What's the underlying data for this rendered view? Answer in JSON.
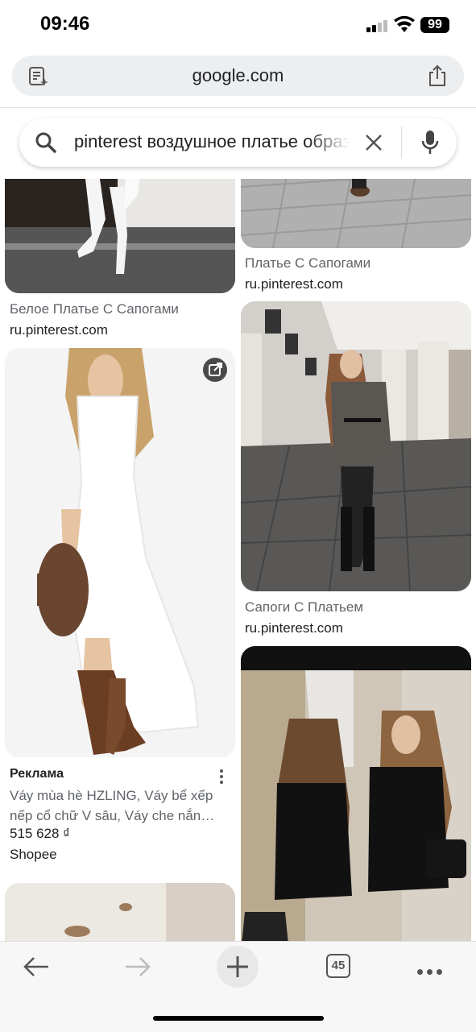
{
  "status": {
    "time": "09:46",
    "battery": "99"
  },
  "browser": {
    "url": "google.com",
    "tab_count": "45"
  },
  "search": {
    "query": "pinterest воздушное платье образ"
  },
  "results": [
    {
      "caption": "Белое Платье С Сапогами",
      "domain": "ru.pinterest.com"
    },
    {
      "caption": "Платье С Сапогами",
      "domain": "ru.pinterest.com"
    },
    {
      "caption": "Сапоги С Платьем",
      "domain": "ru.pinterest.com"
    }
  ],
  "ad": {
    "label": "Реклама",
    "title": "Váy mùa hè HZLING, Váy bể xếp nếp cổ chữ V sâu, Váy che nắn…",
    "price": "515 628 ₫",
    "merchant": "Shopee"
  },
  "icons": [
    "tabs-icon",
    "share-icon",
    "search-icon",
    "clear-icon",
    "mic-icon",
    "external-link-icon",
    "more-options-icon",
    "back-icon",
    "forward-icon",
    "new-tab-icon",
    "tab-switcher-icon",
    "more-icon"
  ]
}
